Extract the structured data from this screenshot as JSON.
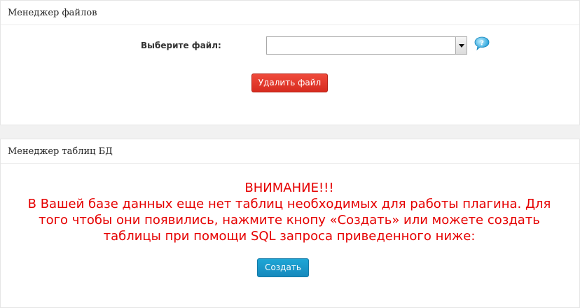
{
  "file_manager": {
    "title": "Менеджер файлов",
    "select_label": "Выберите файл:",
    "selected_file": "",
    "delete_button": "Удалить файл",
    "help_icon": "help-bubble-icon"
  },
  "table_manager": {
    "title": "Менеджер таблиц БД",
    "warning_lines": [
      "ВНИМАНИЕ!!!",
      "В Вашей базе данных еще нет таблиц необходимых для работы плагина. Для",
      "того чтобы они появились, нажмите кнопу «Создать» или можете создать",
      "таблицы при помощи SQL запроса приведенного ниже:"
    ],
    "create_button": "Создать"
  },
  "colors": {
    "warning_text": "#e50000",
    "delete_button": "#e5392c",
    "create_button": "#1b97c9"
  }
}
